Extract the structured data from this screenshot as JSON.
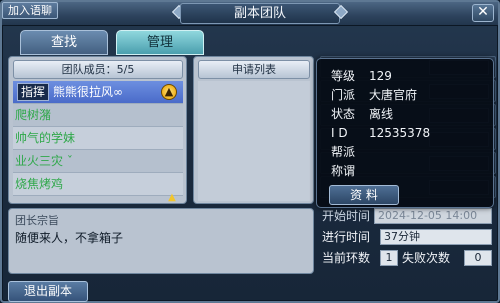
{
  "window": {
    "title": "副本团队",
    "chat_button": "加入语聊",
    "close_label": "✕"
  },
  "tabs": [
    {
      "label": "查找",
      "active": false
    },
    {
      "label": "管理",
      "active": true
    }
  ],
  "members": {
    "header": "团队成员：5/5",
    "leader_tag": "指挥",
    "list": [
      {
        "name": "熊熊很拉风∞",
        "selected": true
      },
      {
        "name": "爬树潴",
        "selected": false
      },
      {
        "name": "帅气的学妹",
        "selected": false
      },
      {
        "name": "业火三灾 ˇ",
        "selected": false
      },
      {
        "name": "烧焦烤鸡",
        "selected": false
      }
    ]
  },
  "applications": {
    "header": "申请列表"
  },
  "player_info": {
    "level_label": "等级",
    "level": "129",
    "sect_label": "门派",
    "sect": "大唐官府",
    "status_label": "状态",
    "status": "离线",
    "id_label": "I  D",
    "id": "12535378",
    "faction_label": "帮派",
    "faction": "",
    "title_label": "称谓",
    "title_value": "",
    "details_button": "资 料"
  },
  "motto": {
    "title": "团长宗旨",
    "text": "随便来人，不拿箱子"
  },
  "stats": {
    "start_time_label": "开始时间",
    "start_time": "2024-12-05 14:00",
    "elapsed_label": "进行时间",
    "elapsed": "37分钟",
    "round_label": "当前环数",
    "round": "1",
    "fail_label": "失败次数",
    "fail": "0"
  },
  "exit_button": "退出副本",
  "colors": {
    "member_name": "#2fa84a",
    "selected_row": "#5a7bd6",
    "manage_tab": "#6cbcc6"
  }
}
